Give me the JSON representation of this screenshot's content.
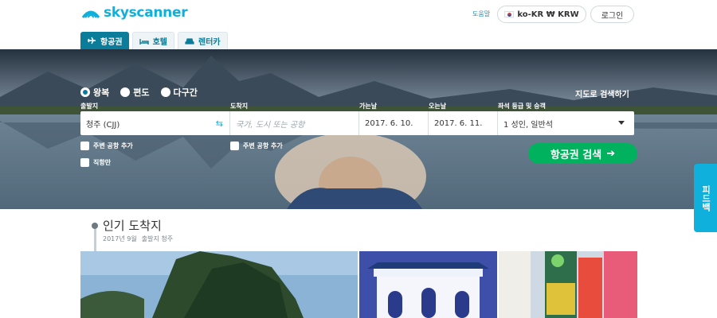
{
  "brand": {
    "name": "skyscanner",
    "color": "#0fb0dc"
  },
  "header": {
    "help": "도움말",
    "locale": "ko-KR ₩ KRW",
    "login": "로그인"
  },
  "tabs": [
    {
      "label": "항공권",
      "icon": "plane-icon",
      "active": true
    },
    {
      "label": "호텔",
      "icon": "bed-icon",
      "active": false
    },
    {
      "label": "렌터카",
      "icon": "car-icon",
      "active": false
    }
  ],
  "search": {
    "trip_types": [
      "왕복",
      "편도",
      "다구간"
    ],
    "selected_trip_type": "왕복",
    "map_search": "지도로 검색하기",
    "labels": {
      "origin": "출발지",
      "destination": "도착지",
      "depart": "가는날",
      "return": "오는날",
      "cabin": "좌석 등급 및 승객"
    },
    "origin_value": "청주 (CJJ)",
    "destination_placeholder": "국가, 도시 또는 공항",
    "depart_value": "2017. 6. 10.",
    "return_value": "2017. 6. 11.",
    "cabin_value": "1 성인, 일반석",
    "nearby_origin": "주변 공항 추가",
    "nearby_destination": "주변 공항 추가",
    "direct_only": "직항만",
    "submit": "항공권 검색",
    "submit_color": "#00b25d"
  },
  "feedback": "피드백",
  "popular": {
    "title": "인기 도착지",
    "date": "2017년 9월",
    "origin": "출발지 청주"
  }
}
